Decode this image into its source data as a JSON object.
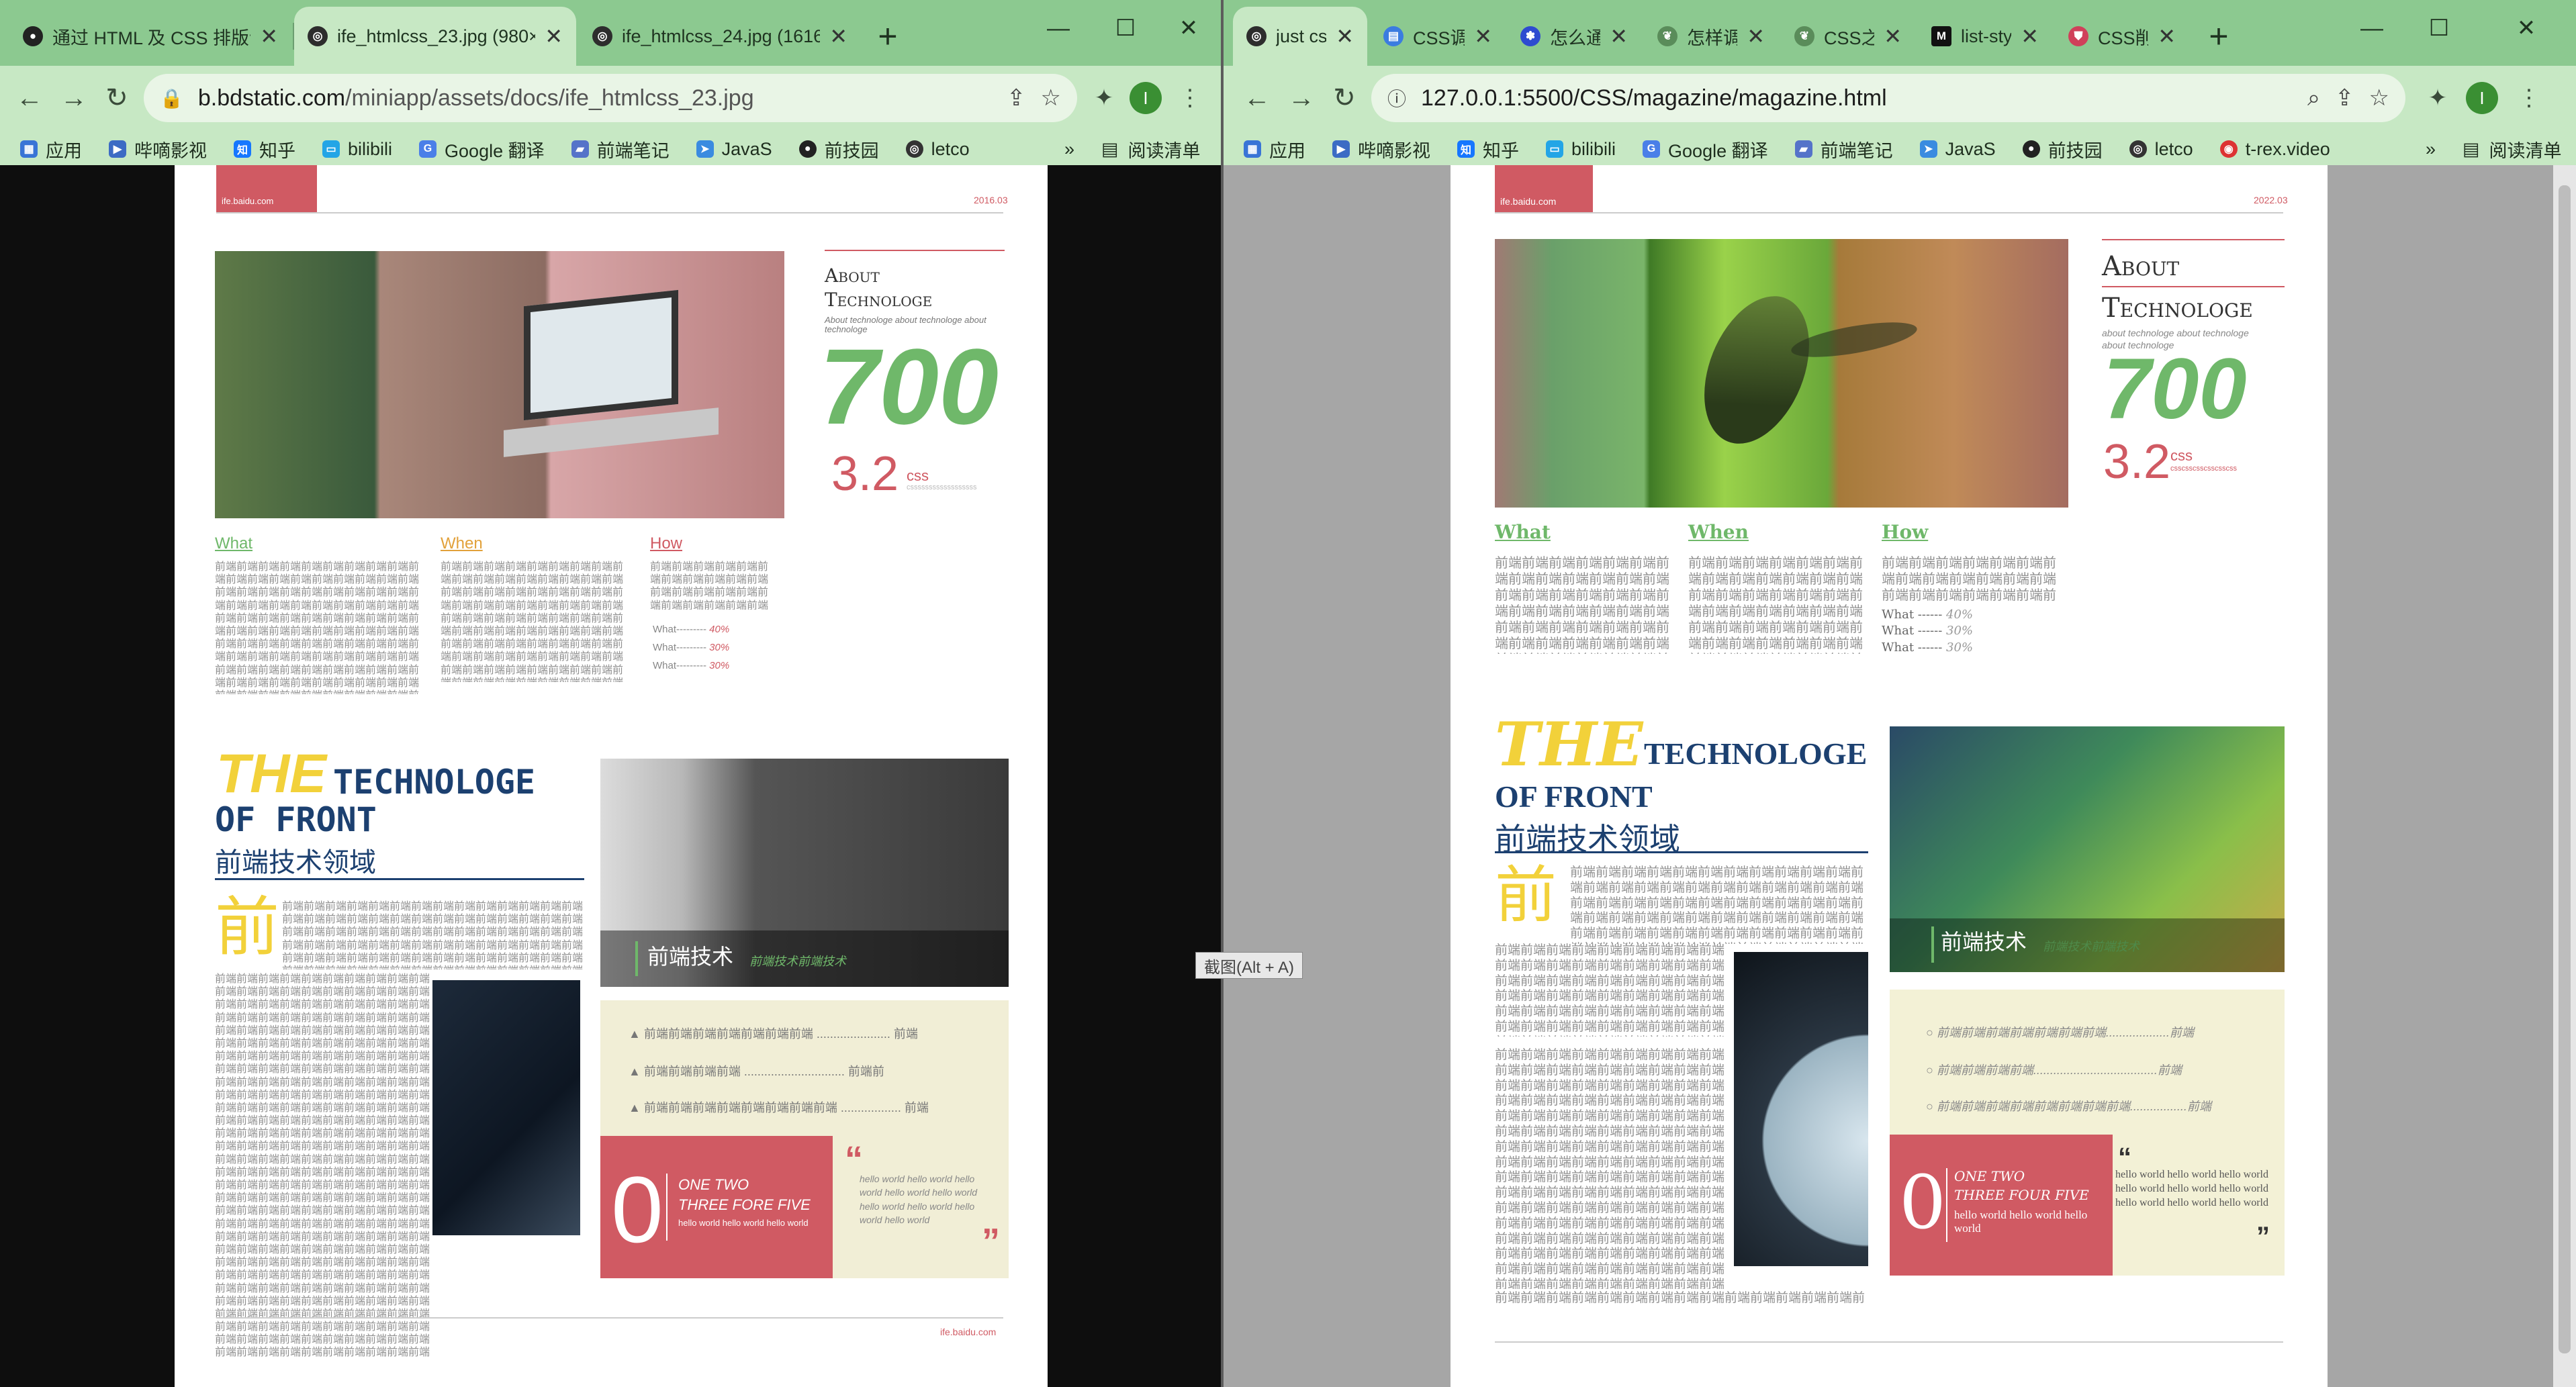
{
  "left_window": {
    "tabs": [
      {
        "title": "通过 HTML 及 CSS 排版设",
        "icon": "github-icon"
      },
      {
        "title": "ife_htmlcss_23.jpg (980×",
        "icon": "globe-icon",
        "active": true
      },
      {
        "title": "ife_htmlcss_24.jpg (1616",
        "icon": "globe-icon"
      }
    ],
    "url_host": "b.bdstatic.com",
    "url_path": "/miniapp/assets/docs/ife_htmlcss_23.jpg",
    "avatar": "I",
    "bookmarks": [
      "应用",
      "哔嘀影视",
      "知乎",
      "bilibili",
      "Google 翻译",
      "前端笔记",
      "JavaS",
      "前技园",
      "letco"
    ],
    "reading_list": "阅读清单",
    "more": "»"
  },
  "right_window": {
    "tabs": [
      {
        "title": "just css",
        "icon": "globe-icon",
        "active": true
      },
      {
        "title": "CSS调",
        "icon": "doc-icon"
      },
      {
        "title": "怎么通",
        "icon": "paw-icon"
      },
      {
        "title": "怎样调",
        "icon": "leaf-icon"
      },
      {
        "title": "CSS之",
        "icon": "leaf-icon"
      },
      {
        "title": "list-sty",
        "icon": "m-icon"
      },
      {
        "title": "CSS削",
        "icon": "shield-icon"
      }
    ],
    "url_host": "127.0.0.1",
    "url_path": ":5500/CSS/magazine/magazine.html",
    "avatar": "I",
    "bookmarks": [
      "应用",
      "哔嘀影视",
      "知乎",
      "bilibili",
      "Google 翻译",
      "前端笔记",
      "JavaS",
      "前技园",
      "letco",
      "t-rex.video"
    ],
    "reading_list": "阅读清单",
    "more": "»"
  },
  "left_page": {
    "logo": "ife.baidu.com",
    "date": "2016.03",
    "about": "About",
    "technologe": "Technologe",
    "about_sub": "About technologe about technologe about technologe",
    "big_number": "700",
    "version": "3.2",
    "css": "css",
    "css_small": "cssssssssssssssssss",
    "what": "What",
    "when": "When",
    "how": "How",
    "stat_label": "What---------",
    "stats": [
      "40%",
      "30%",
      "30%"
    ],
    "the": "THE",
    "technologe_title": "TECHNOLOGE",
    "of_front": "OF FRONT",
    "chinese_title": "前端技术领域",
    "big_char": "前",
    "banner_title": "前端技术",
    "banner_sub": "前端技术前端技术",
    "list_items": [
      {
        "text": "前端前端前端前端前端前端前端",
        "dots": "......................",
        "end": "前端"
      },
      {
        "text": "前端前端前端前端",
        "dots": "..............................",
        "end": "前端前"
      },
      {
        "text": "前端前端前端前端前端前端前端前端",
        "dots": "..................",
        "end": "前端"
      }
    ],
    "zero": "0",
    "one_two": "ONE TWO",
    "three_five": "THREE FORE FIVE",
    "hello_small": "hello world hello world hello world",
    "quote_open": "“",
    "quote_close": "”",
    "quote_text": "hello world hello world hello world hello world hello world hello world hello world hello world hello world",
    "footer": "ife.baidu.com"
  },
  "right_page": {
    "logo": "ife.baidu.com",
    "date": "2022.03",
    "about": "About",
    "technologe": "Technologe",
    "about_sub": "about technologe about technologe about technologe",
    "big_number": "700",
    "version": "3.2",
    "css": "css",
    "css_small": "csscsscsscsscsscss",
    "what": "What",
    "when": "When",
    "how": "How",
    "stat_label": "What ------",
    "stats": [
      "40%",
      "30%",
      "30%"
    ],
    "the": "THE",
    "technologe_title": "TECHNOLOGE",
    "of_front": "OF FRONT",
    "chinese_title": "前端技术领域",
    "big_char": "前",
    "banner_title": "前端技术",
    "banner_sub": "前端技术前端技术",
    "list_items": [
      {
        "text": "前端前端前端前端前端前端前端",
        "dots": "...................",
        "end": "前端"
      },
      {
        "text": "前端前端前端前端",
        "dots": ".....................................",
        "end": "前端"
      },
      {
        "text": "前端前端前端前端前端前端前端前端",
        "dots": ".................",
        "end": "前端"
      }
    ],
    "zero": "0",
    "one_two": "ONE TWO",
    "three_five": "THREE FOUR FIVE",
    "hello_small": "hello world hello world hello world",
    "quote_open": "“",
    "quote_close": "”",
    "quote_text": "hello world hello world hello world hello world hello world hello world hello world hello world hello world"
  },
  "filler": {
    "zh": "前端前端前端前端前端前端前端前端前端前端前端前端前端前端前端前端前端前端前端前端前端前端前端前端前端前端前端前端前端前端前端前端前端前端前端前端前端前端前端前端前端前端前端前端前端前端前端前端前端前端前端前端前端前端前端前端前端前端前端前端前端前端前端前端前端前端前端前端前端前端前端前端前端前端前端前端前端前端前端前端前端前端前端前端前端前端前端前端前端前端前端前端前端前端前端前端前端前端前端前端前端前端前端前端前端前端前端前端前端前端前端前端前端前端前端前端前端前端前端前端前端前端前端前端前端前端前端前端前端前端前端前端前端前端前端前端前端前端前端前端前端前端前端前端前端前端前端前端前端前端前端前端前端前端前端前端前端前端前端前端前端前端前端前端前端前端前端前端前端前端前端前端前端前端前端前端前端前端前端前端前端前端前端前端前端前端前端前端前端前端前端前端前端前端前端前端前端前端前端前端前端前端前端前端前端前端前端前端前端前端前端前端前端前端前端前端前端前端前端前端前端前端前端前端前端前端前端前端前端前端前端前端前端前端前端前端前端前端前端前端前端前端前端前端前端前端前端前端前端前端前端前端前端前端前端前端前端前端前端前端前端前端前端前端前端前端前端前端前端前端前端前端前端前端前端前端前端前端前端前端前端前端前端前端前端前端前端前端前端前端前端前端前端前端前端前端前端前端前端前端"
  },
  "tooltip": "截图(Alt + A)",
  "colors": {
    "tab_bar": "#8cc990",
    "toolbar": "#c7e8c4",
    "accent_green": "#6fb86a",
    "accent_pink": "#d05a63",
    "accent_navy": "#1c4070",
    "accent_yellow": "#f2d13a",
    "cream": "#f1eed6"
  }
}
